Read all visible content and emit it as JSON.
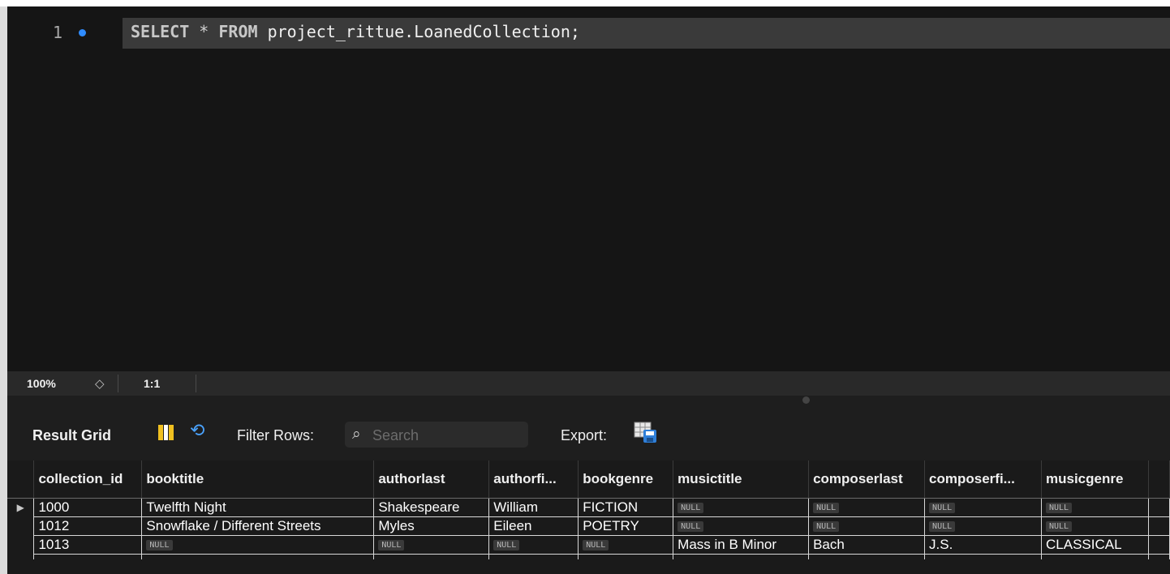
{
  "editor": {
    "line_number": "1",
    "sql": {
      "kw_select": "SELECT",
      "star": " * ",
      "kw_from": "FROM",
      "rest": " project_rittue.LoanedCollection;"
    }
  },
  "status": {
    "zoom": "100%",
    "zoom_stepper_icon": "up-down-chevron-icon",
    "cursor_position": "1:1"
  },
  "toolbar": {
    "result_grid_label": "Result Grid",
    "filter_rows_label": "Filter Rows:",
    "search_placeholder": "Search",
    "search_value": "",
    "export_label": "Export:",
    "icons": [
      "grid-layout-icon",
      "refresh-icon",
      "search-icon",
      "export-icon"
    ]
  },
  "colors": {
    "editor_bg": "#151515",
    "keyword": "#c8c8c8",
    "line_marker": "#2f8cff",
    "refresh_accent": "#4aa3ff",
    "grid_icon_accent": "#f0c020"
  },
  "table": {
    "columns": [
      "collection_id",
      "booktitle",
      "authorlast",
      "authorfi...",
      "bookgenre",
      "musictitle",
      "composerlast",
      "composerfi...",
      "musicgenre"
    ],
    "row_marker": "▶",
    "rows": [
      [
        "1000",
        "Twelfth Night",
        "Shakespeare",
        "William",
        "FICTION",
        "NULL",
        "NULL",
        "NULL",
        "NULL"
      ],
      [
        "1012",
        "Snowflake / Different Streets",
        "Myles",
        "Eileen",
        "POETRY",
        "NULL",
        "NULL",
        "NULL",
        "NULL"
      ],
      [
        "1013",
        "NULL",
        "NULL",
        "NULL",
        "NULL",
        "Mass in B Minor",
        "Bach",
        "J.S.",
        "CLASSICAL"
      ]
    ]
  }
}
